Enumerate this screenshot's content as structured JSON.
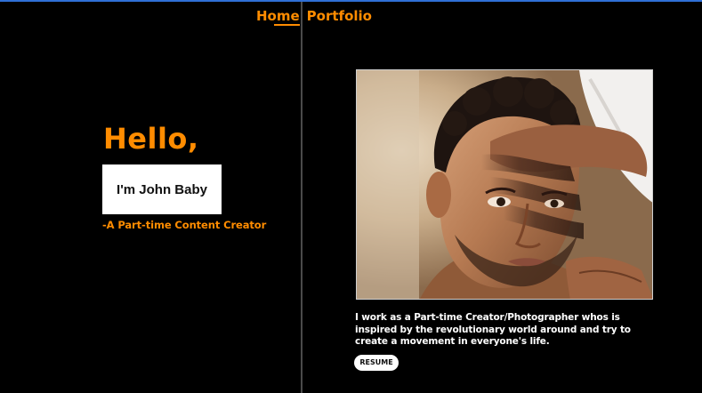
{
  "nav": {
    "items": [
      {
        "label": "Home",
        "active": true
      },
      {
        "label": "Portfolio",
        "active": false
      }
    ]
  },
  "hero": {
    "greeting": "Hello,",
    "name": "I'm John Baby",
    "tagline": "-A Part-time Content Creator"
  },
  "about": {
    "photo_icon": "portrait-photo-icon",
    "bio": "I work as a Part-time Creator/Photographer whos is inspired by the revolutionary world around and try to create a movement in everyone's life.",
    "resume_label": "RESUME"
  },
  "colors": {
    "accent": "#ff8c00",
    "background": "#000000",
    "text": "#ffffff",
    "top_border": "#2f6fd6"
  }
}
